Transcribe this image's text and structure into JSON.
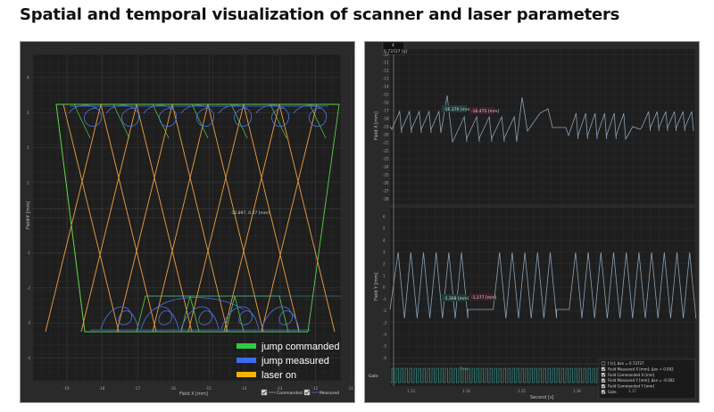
{
  "page_title": "Spatial and temporal visualization of scanner and laser parameters",
  "left_panel": {
    "y_axis_label": "Field Y [mm]",
    "x_axis_label": "Field X [mm]",
    "y_ticks": [
      "4",
      "3",
      "2",
      "1",
      "0",
      "-1",
      "-2",
      "-3",
      "-4"
    ],
    "x_ticks": [
      "-19",
      "-18",
      "-17",
      "-16",
      "-15",
      "-14",
      "-13",
      "-12",
      "-11",
      "-10"
    ],
    "cursor_readout": "-12.897, 0.27 [mm]",
    "legend": [
      {
        "label": "jump commanded",
        "color": "#2ecc40"
      },
      {
        "label": "jump measured",
        "color": "#3a6cf0"
      },
      {
        "label": "laser on",
        "color": "#f5a623"
      }
    ],
    "checkboxes": [
      {
        "label": "Commanded",
        "checked": true
      },
      {
        "label": "Measured",
        "checked": true
      }
    ],
    "colors": {
      "commanded": "#5ad04a",
      "measured": "#4a78e8",
      "laser": "#f0a040"
    }
  },
  "right_panel": {
    "time_header": "0.73727 [s]",
    "time_header_top": "4",
    "top_y_label": "Field X [mm]",
    "top_y_ticks": [
      "-10",
      "-11",
      "-12",
      "-13",
      "-14",
      "-15",
      "-16",
      "-17",
      "-18",
      "-19",
      "-20",
      "-21",
      "-22",
      "-23",
      "-24",
      "-25",
      "-26",
      "-27",
      "-28"
    ],
    "top_value_labels": [
      "-16.370 [mm]",
      "-16.475 [mm]"
    ],
    "bottom_y_label": "Field Y [mm]",
    "bottom_y_ticks": [
      "6",
      "5",
      "4",
      "3",
      "2",
      "1",
      "0",
      "-1",
      "-2",
      "-3",
      "-4",
      "-5",
      "-6"
    ],
    "bottom_value_labels": [
      "-1.368 [mm]",
      "-1.277 [mm]"
    ],
    "gate_label": "Gate",
    "gate_value": "True",
    "x_axis_label": "Second [s]",
    "x_ticks": [
      "1.13",
      "1.14",
      "1.15",
      "1.16",
      "1.17"
    ],
    "legend_items": [
      {
        "label": "t [s]; Δxx = 0.73727",
        "checked": false
      },
      {
        "label": "Field Measured X [mm]; Δxx = 0.002",
        "checked": true
      },
      {
        "label": "Field Commanded X [mm]",
        "checked": true
      },
      {
        "label": "Field Measured Y [mm]; Δxx = -0.002",
        "checked": true
      },
      {
        "label": "Field Commanded Y [mm]",
        "checked": true
      },
      {
        "label": "Gate",
        "checked": true
      }
    ],
    "colors": {
      "trace": "#8aa2b8",
      "gate": "#3ea8a0"
    }
  }
}
